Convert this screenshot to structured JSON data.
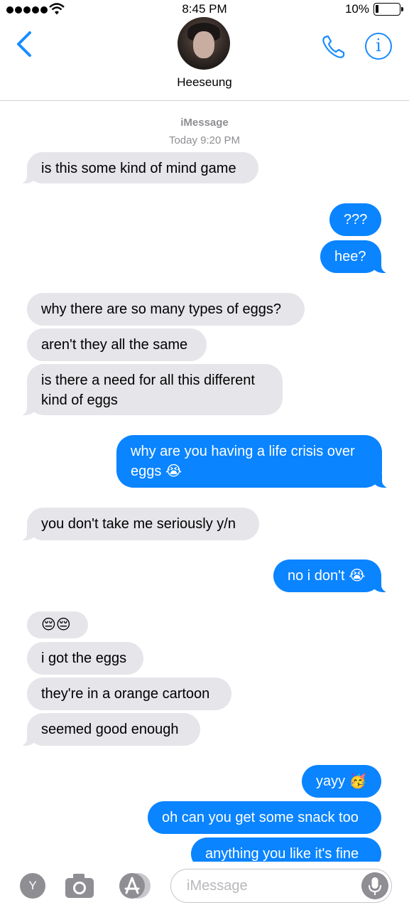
{
  "status_bar": {
    "time": "8:45 PM",
    "battery_percent": "10%",
    "battery_level": 0.1,
    "signal_bars": 5
  },
  "header": {
    "contact_name": "Heeseung",
    "back_icon": "chevron-left-icon",
    "call_icon": "phone-icon",
    "info_icon": "info-icon",
    "info_glyph": "i",
    "accent_color": "#1a8cff"
  },
  "thread": {
    "service": "iMessage",
    "timestamp": "Today 9:20 PM",
    "messages": [
      {
        "from": "them",
        "text": "is this some kind of mind game"
      },
      {
        "from": "me",
        "text": "???"
      },
      {
        "from": "me",
        "text": "hee?"
      },
      {
        "from": "them",
        "text": "why there are so many types of eggs?"
      },
      {
        "from": "them",
        "text": "aren't they all the same"
      },
      {
        "from": "them",
        "text": "is there a need for all this different kind of eggs"
      },
      {
        "from": "me",
        "text": "why are you having a life crisis over eggs 😭"
      },
      {
        "from": "them",
        "text": "you don't take me seriously y/n"
      },
      {
        "from": "me",
        "text": "no i don't 😭"
      },
      {
        "from": "them",
        "text": "😔😔"
      },
      {
        "from": "them",
        "text": "i got the eggs"
      },
      {
        "from": "them",
        "text": "they're in a orange cartoon"
      },
      {
        "from": "them",
        "text": "seemed good enough"
      },
      {
        "from": "me",
        "text": "yayy 🥳"
      },
      {
        "from": "me",
        "text": "oh can you get some snack too"
      },
      {
        "from": "me",
        "text": "anything you like it's fine"
      }
    ],
    "incoming_color": "#e5e5ea",
    "outgoing_color": "#0a84ff"
  },
  "input_bar": {
    "app_button_label": "Y",
    "placeholder": "iMessage",
    "camera_icon": "camera-icon",
    "appstore_icon": "appstore-icon",
    "mic_icon": "microphone-icon"
  }
}
